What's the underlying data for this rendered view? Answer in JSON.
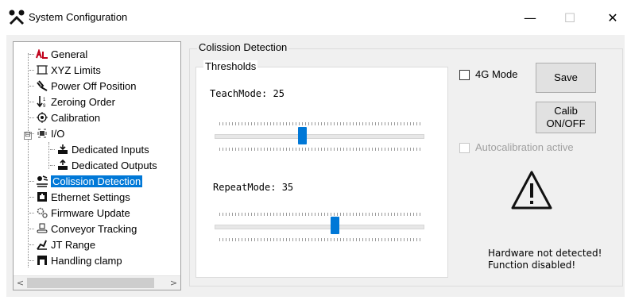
{
  "window": {
    "title": "System Configuration",
    "icon": "tools-icon",
    "minimize_glyph": "—",
    "maximize_glyph": "☐",
    "close_glyph": "✕"
  },
  "tree": {
    "items": [
      {
        "label": "General",
        "icon": "general-icon"
      },
      {
        "label": "XYZ Limits",
        "icon": "xyz-limits-icon"
      },
      {
        "label": "Power Off Position",
        "icon": "power-off-icon"
      },
      {
        "label": "Zeroing Order",
        "icon": "zeroing-order-icon"
      },
      {
        "label": "Calibration",
        "icon": "calibration-icon"
      },
      {
        "label": "I/O",
        "icon": "io-icon",
        "expander": "⊟"
      },
      {
        "label": "Dedicated Inputs",
        "icon": "dedicated-inputs-icon"
      },
      {
        "label": "Dedicated Outputs",
        "icon": "dedicated-outputs-icon"
      },
      {
        "label": "Colission Detection",
        "icon": "collision-icon",
        "selected": true
      },
      {
        "label": "Ethernet Settings",
        "icon": "ethernet-icon"
      },
      {
        "label": "Firmware Update",
        "icon": "firmware-icon"
      },
      {
        "label": "Conveyor Tracking",
        "icon": "conveyor-icon"
      },
      {
        "label": "JT Range",
        "icon": "jt-range-icon"
      },
      {
        "label": "Handling clamp",
        "icon": "clamp-icon"
      }
    ],
    "scroll_left": "<",
    "scroll_right": ">"
  },
  "collision": {
    "group_title": "Colission Detection",
    "thresholds_title": "Thresholds",
    "teach_label": "TeachMode: 25",
    "teach_value": 25,
    "repeat_label": "RepeatMode: 35",
    "repeat_value": 35,
    "slider_max": 60,
    "mode4g_label": "4G Mode",
    "mode4g_checked": false,
    "save_label": "Save",
    "calib_label_line1": "Calib",
    "calib_label_line2": "ON/OFF",
    "autocal_label": "Autocalibration active",
    "autocal_checked": false,
    "warning_line1": "Hardware not detected!",
    "warning_line2": "Function disabled!",
    "warning_icon": "warning-triangle-icon"
  },
  "colors": {
    "accent": "#0078d7",
    "button_bg": "#e1e1e1",
    "panel_bg": "#f0f0f0"
  }
}
